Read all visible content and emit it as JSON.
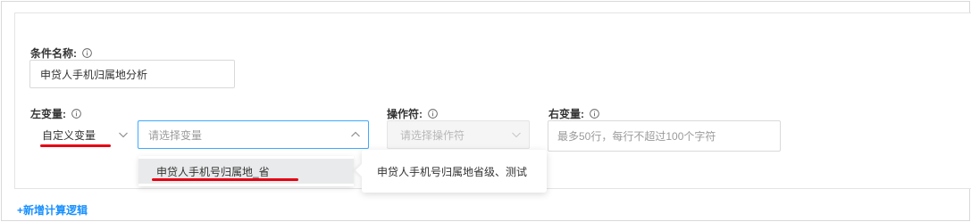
{
  "condition": {
    "label": "条件名称:",
    "value": "申贷人手机归属地分析"
  },
  "left_variable": {
    "label": "左变量:",
    "type_value": "自定义变量",
    "variable_placeholder": "请选择变量",
    "dropdown_option": "申贷人手机号归属地_省",
    "tooltip": "申贷人手机号归属地省级、测试"
  },
  "operator": {
    "label": "操作符:",
    "placeholder": "请选择操作符"
  },
  "right_variable": {
    "label": "右变量:",
    "placeholder": "最多50行，每行不超过100个字符"
  },
  "add_logic_link": "+新增计算逻辑",
  "icons": [
    "info-icon",
    "chevron-down-icon",
    "chevron-up-icon"
  ],
  "colors": {
    "accent": "#1890ff",
    "annotation": "#e60012",
    "border": "#d9d9d9",
    "selected_option_bg": "#e9eaeb"
  }
}
